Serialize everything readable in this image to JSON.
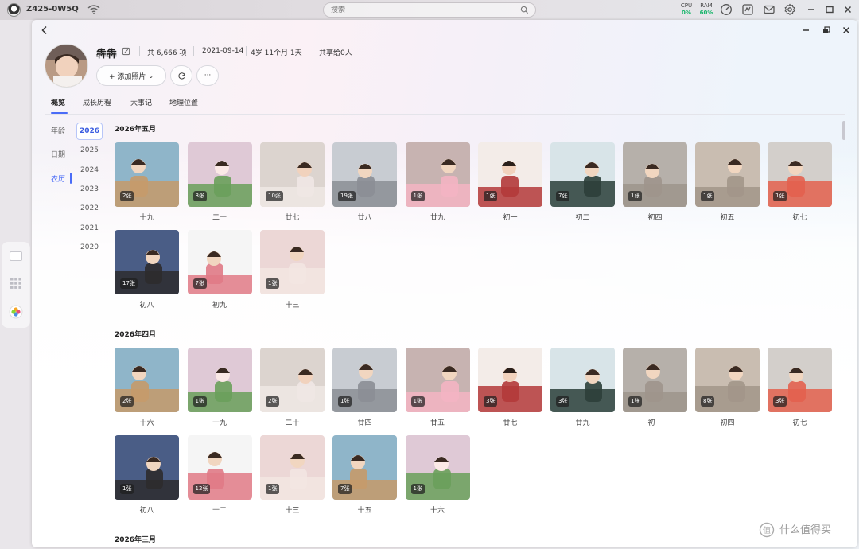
{
  "system_bar": {
    "device_name": "Z425-0W5Q",
    "search_placeholder": "搜索",
    "cpu_label": "CPU",
    "cpu_value": "0%",
    "ram_label": "RAM",
    "ram_value": "60%",
    "accent": "#16b56a"
  },
  "profile": {
    "name": "犇犇",
    "total_items": "共 6,666 项",
    "birth_date": "2021-09-14",
    "age": "4岁 11个月 1天",
    "shared": "共享给0人",
    "add_photo_label": "+ 添加照片",
    "more_label": "···"
  },
  "tabs": [
    {
      "label": "概览",
      "active": true
    },
    {
      "label": "成长历程",
      "active": false
    },
    {
      "label": "大事记",
      "active": false
    },
    {
      "label": "地理位置",
      "active": false
    }
  ],
  "modes": [
    {
      "label": "年龄",
      "active": false
    },
    {
      "label": "日期",
      "active": false
    },
    {
      "label": "农历",
      "active": true
    }
  ],
  "years": [
    {
      "label": "2026",
      "active": true
    },
    {
      "label": "2025",
      "active": false
    },
    {
      "label": "2024",
      "active": false
    },
    {
      "label": "2023",
      "active": false
    },
    {
      "label": "2022",
      "active": false
    },
    {
      "label": "2021",
      "active": false
    },
    {
      "label": "2020",
      "active": false
    }
  ],
  "months": [
    {
      "title": "2026年五月",
      "photos": [
        {
          "count": "2张",
          "day": "十九"
        },
        {
          "count": "8张",
          "day": "二十"
        },
        {
          "count": "10张",
          "day": "廿七"
        },
        {
          "count": "19张",
          "day": "廿八"
        },
        {
          "count": "1张",
          "day": "廿九"
        },
        {
          "count": "1张",
          "day": "初一"
        },
        {
          "count": "7张",
          "day": "初二"
        },
        {
          "count": "1张",
          "day": "初四"
        },
        {
          "count": "1张",
          "day": "初五"
        },
        {
          "count": "1张",
          "day": "初七"
        },
        {
          "count": "17张",
          "day": "初八"
        },
        {
          "count": "7张",
          "day": "初九"
        },
        {
          "count": "1张",
          "day": "十三"
        }
      ]
    },
    {
      "title": "2026年四月",
      "photos": [
        {
          "count": "2张",
          "day": "十六"
        },
        {
          "count": "1张",
          "day": "十九"
        },
        {
          "count": "2张",
          "day": "二十"
        },
        {
          "count": "1张",
          "day": "廿四"
        },
        {
          "count": "1张",
          "day": "廿五"
        },
        {
          "count": "3张",
          "day": "廿七"
        },
        {
          "count": "3张",
          "day": "廿九"
        },
        {
          "count": "1张",
          "day": "初一"
        },
        {
          "count": "8张",
          "day": "初四"
        },
        {
          "count": "3张",
          "day": "初七"
        },
        {
          "count": "1张",
          "day": "初八"
        },
        {
          "count": "12张",
          "day": "十二"
        },
        {
          "count": "1张",
          "day": "十三"
        },
        {
          "count": "7张",
          "day": "十五"
        },
        {
          "count": "1张",
          "day": "十六"
        }
      ]
    },
    {
      "title": "2026年三月",
      "photos": []
    }
  ],
  "watermark": "值 什么值得买",
  "colors": {
    "accent": "#4a6cf7",
    "badge_bg": "#1e1e1e"
  }
}
